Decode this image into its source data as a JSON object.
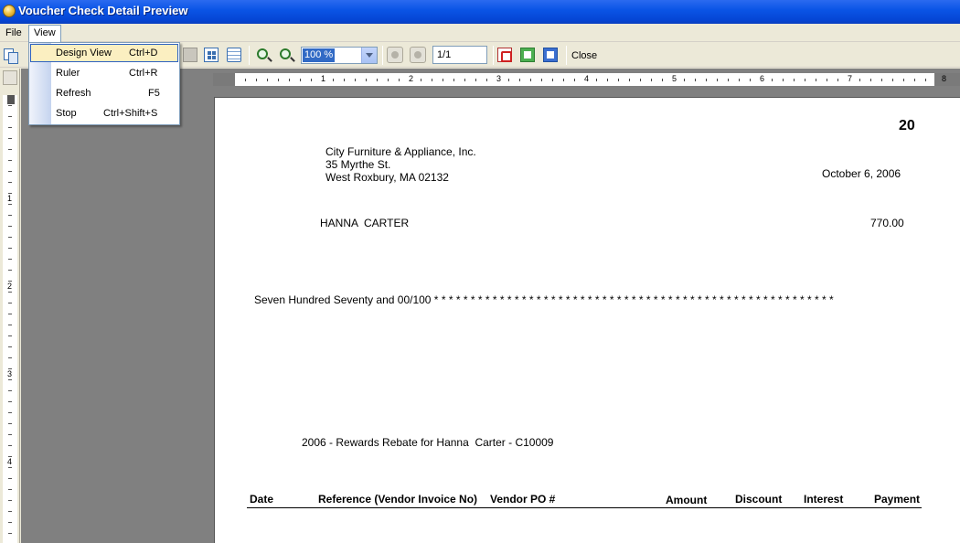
{
  "window": {
    "title": "Voucher Check Detail Preview"
  },
  "menubar": {
    "file": "File",
    "view": "View"
  },
  "view_menu": {
    "items": [
      {
        "label": "Design View",
        "shortcut": "Ctrl+D"
      },
      {
        "label": "Ruler",
        "shortcut": "Ctrl+R"
      },
      {
        "label": "Refresh",
        "shortcut": "F5"
      },
      {
        "label": "Stop",
        "shortcut": "Ctrl+Shift+S"
      }
    ]
  },
  "toolbar": {
    "zoom": "100 %",
    "page": "1/1",
    "close_label": "Close",
    "icons": [
      "copy-icon",
      "page-layout-icon",
      "multi-page-icon",
      "print-icon",
      "zoom-out-icon",
      "zoom-in-icon",
      "prev-page-icon",
      "next-page-icon",
      "pdf-export-icon",
      "excel-export-icon",
      "word-export-icon"
    ]
  },
  "ruler": {
    "h_marks": [
      "1",
      "2",
      "3",
      "4",
      "5",
      "6",
      "7",
      "8"
    ],
    "v_marks": [
      "1",
      "2",
      "3",
      "4"
    ]
  },
  "check": {
    "number": "20",
    "company": {
      "name": "City Furniture & Appliance, Inc.",
      "street": "35 Myrthe St.",
      "city": "West Roxbury, MA 02132"
    },
    "date": "October 6, 2006",
    "payee": "HANNA  CARTER",
    "amount": "770.00",
    "amount_words": "Seven Hundred Seventy and 00/100 * * * * * * * * * * * * * * * * * * * * * * * * * * * * * * * * * * * * * * * * * * * * * * * * * * * * * * *",
    "memo": "2006 - Rewards Rebate for Hanna  Carter - C10009",
    "columns": [
      "Date",
      "Reference (Vendor Invoice No)",
      "Vendor PO #",
      "Amount",
      "Discount",
      "Interest",
      "Payment"
    ]
  }
}
